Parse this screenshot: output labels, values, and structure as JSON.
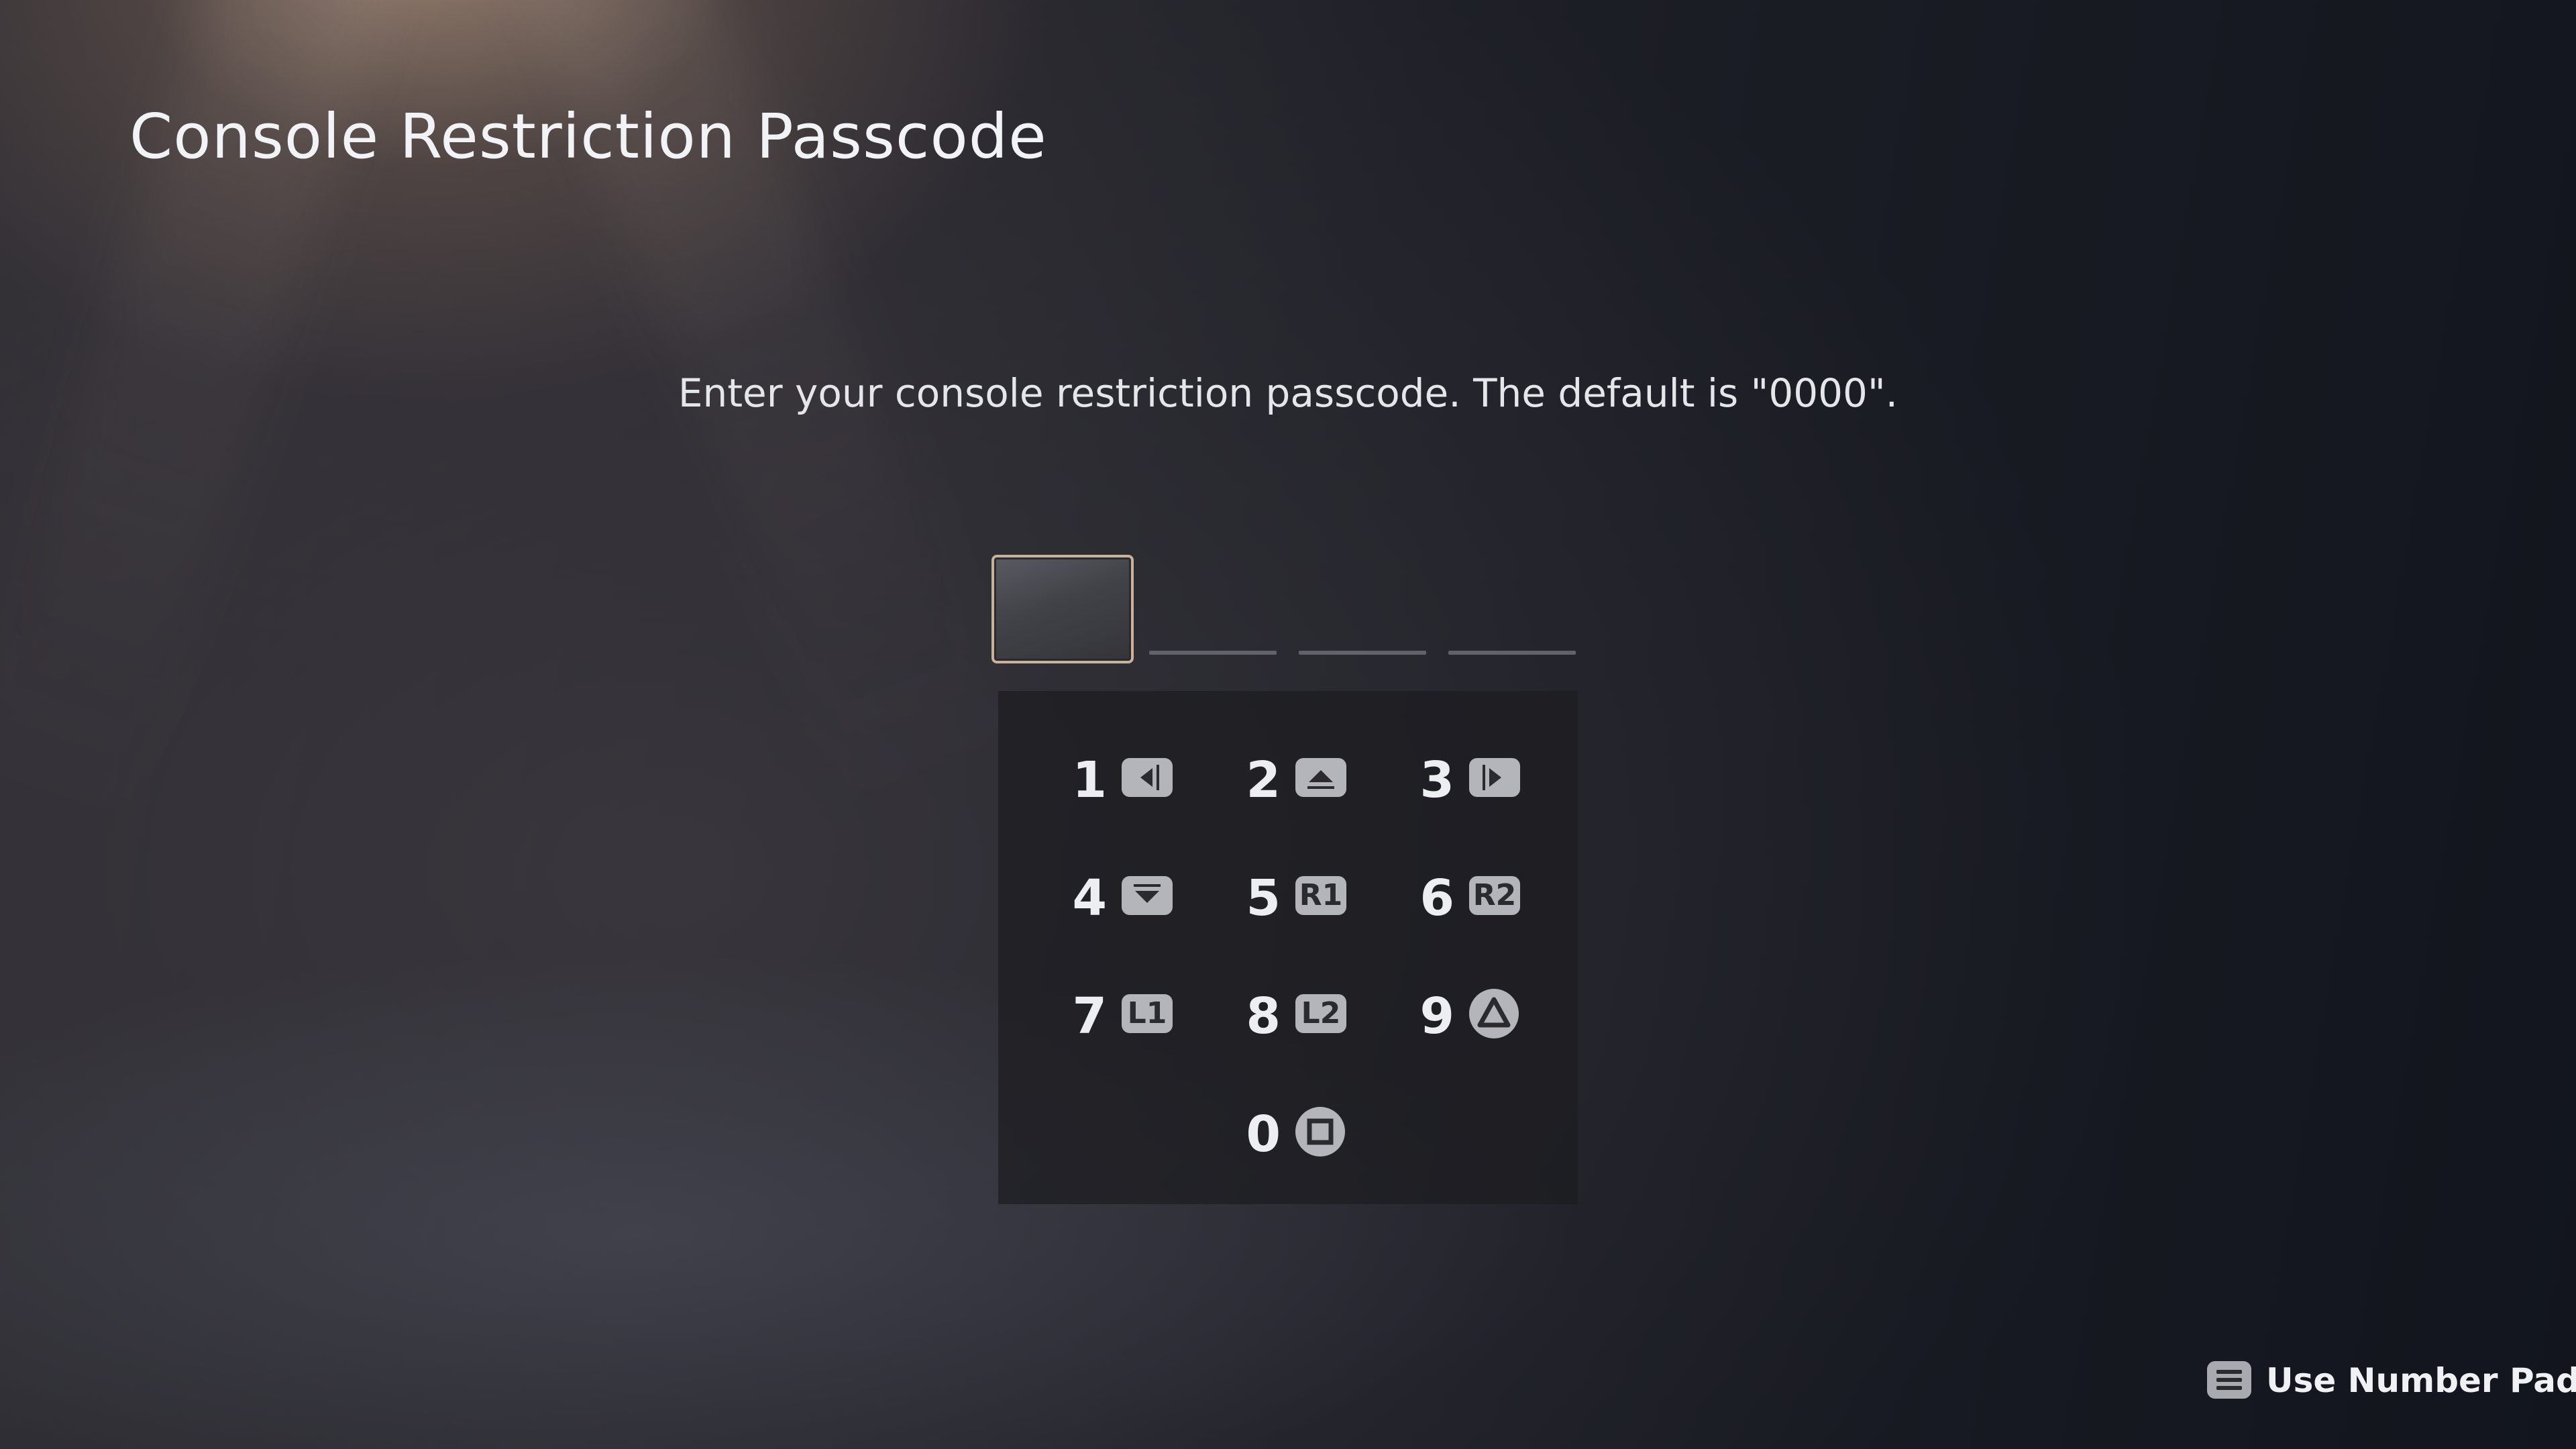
{
  "title": "Console Restriction Passcode",
  "instruction": "Enter your console restriction passcode. The default is \"0000\".",
  "passcode": {
    "digit_count": 4,
    "active_index": 0
  },
  "keypad": {
    "keys": [
      {
        "number": "1",
        "button": "",
        "icon": "dpad-left-icon"
      },
      {
        "number": "2",
        "button": "",
        "icon": "dpad-up-icon"
      },
      {
        "number": "3",
        "button": "",
        "icon": "dpad-right-icon"
      },
      {
        "number": "4",
        "button": "",
        "icon": "dpad-down-icon"
      },
      {
        "number": "5",
        "button": "R1",
        "icon": "r1-button-icon"
      },
      {
        "number": "6",
        "button": "R2",
        "icon": "r2-button-icon"
      },
      {
        "number": "7",
        "button": "L1",
        "icon": "l1-button-icon"
      },
      {
        "number": "8",
        "button": "L2",
        "icon": "l2-button-icon"
      },
      {
        "number": "9",
        "button": "",
        "icon": "triangle-button-icon"
      },
      {
        "number": "0",
        "button": "",
        "icon": "square-button-icon"
      }
    ]
  },
  "footer": {
    "hint_label": "Use Number Pad",
    "hint_icon": "options-button-icon"
  },
  "colors": {
    "active_border": "#c9b19c",
    "text": "#eceef2"
  }
}
